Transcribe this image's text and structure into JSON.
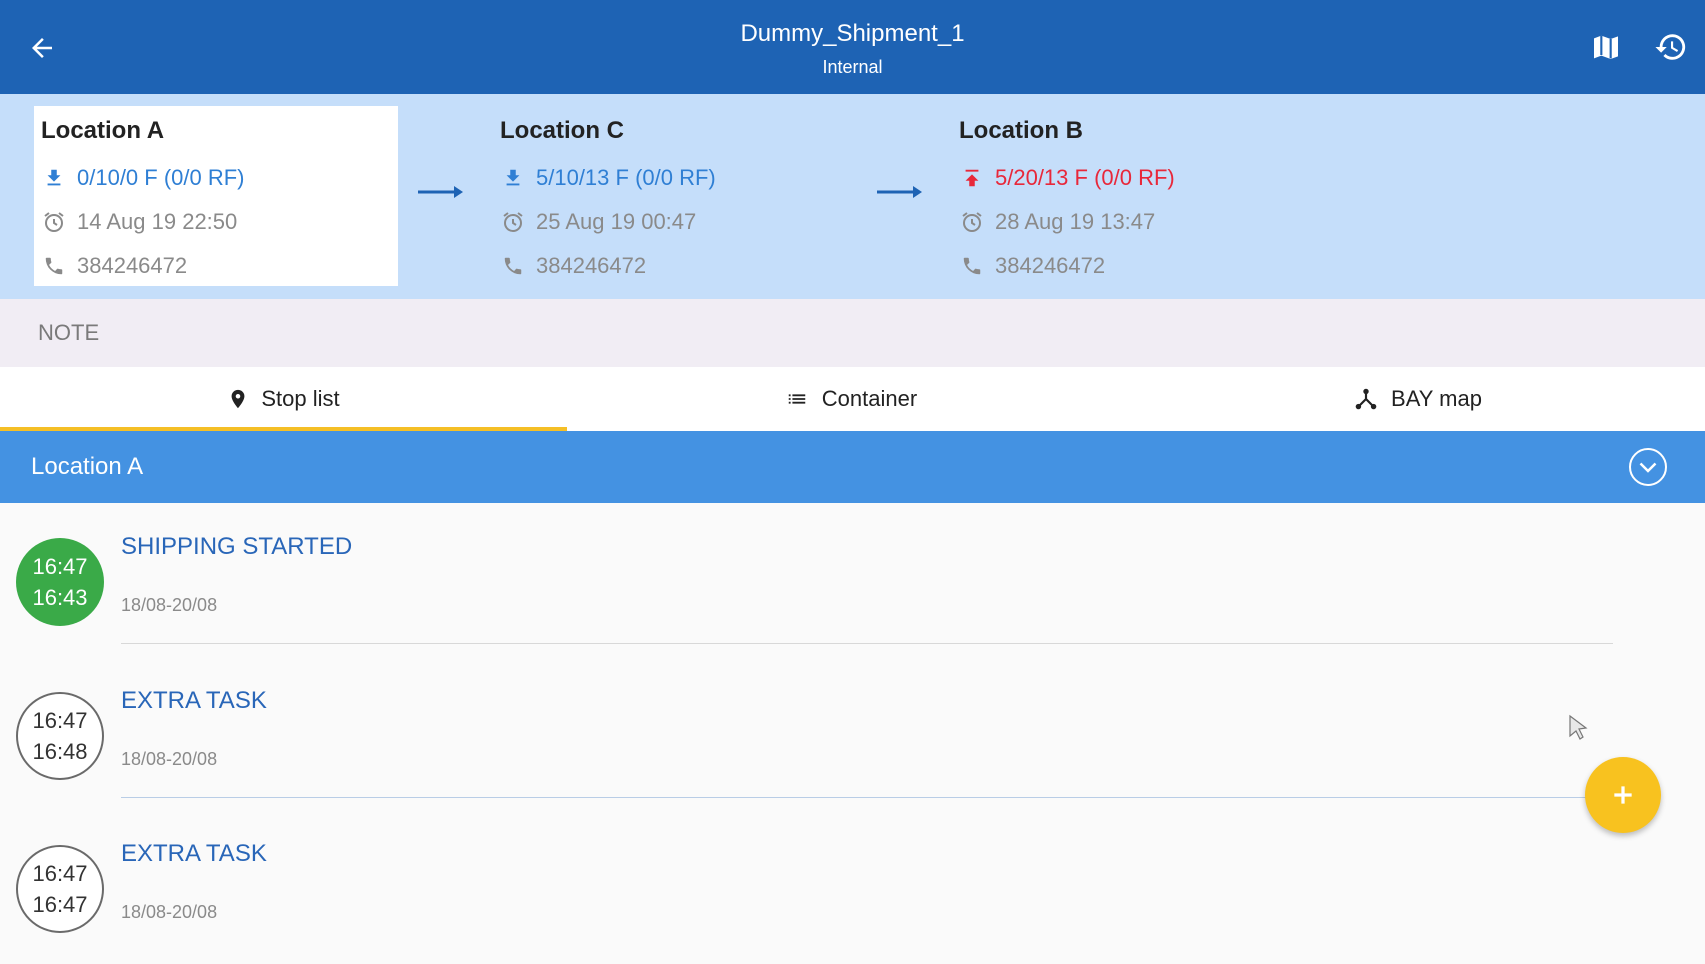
{
  "header": {
    "title": "Dummy_Shipment_1",
    "subtitle": "Internal",
    "back_icon": "arrow-left-icon",
    "map_icon": "map-icon",
    "history_icon": "history-icon"
  },
  "stops": [
    {
      "name": "Location A",
      "count": "0/10/0 F (0/0 RF)",
      "count_icon": "download-icon",
      "count_color": "#2f7fd4",
      "time": "14 Aug 19 22:50",
      "phone": "384246472",
      "active": true
    },
    {
      "name": "Location C",
      "count": "5/10/13 F (0/0 RF)",
      "count_icon": "download-icon",
      "count_color": "#2f7fd4",
      "time": "25 Aug 19 00:47",
      "phone": "384246472",
      "active": false
    },
    {
      "name": "Location B",
      "count": "5/20/13 F (0/0 RF)",
      "count_icon": "upload-icon",
      "count_color": "#e8283a",
      "time": "28 Aug 19 13:47",
      "phone": "384246472",
      "active": false
    }
  ],
  "note": {
    "label": "NOTE"
  },
  "tabs": [
    {
      "label": "Stop list",
      "icon": "location-pin-icon",
      "active": true
    },
    {
      "label": "Container",
      "icon": "list-icon",
      "active": false
    },
    {
      "label": "BAY map",
      "icon": "hub-icon",
      "active": false
    }
  ],
  "section": {
    "title": "Location A",
    "icon": "chevron-down-circle-icon"
  },
  "tasks": [
    {
      "time_top": "16:47",
      "time_bottom": "16:43",
      "name": "SHIPPING STARTED",
      "dates": "18/08-20/08",
      "status": "done"
    },
    {
      "time_top": "16:47",
      "time_bottom": "16:48",
      "name": "EXTRA TASK",
      "dates": "18/08-20/08",
      "status": "pending"
    },
    {
      "time_top": "16:47",
      "time_bottom": "16:47",
      "name": "EXTRA TASK",
      "dates": "18/08-20/08",
      "status": "pending"
    }
  ],
  "fab": {
    "icon": "plus-icon",
    "color": "#f8c21f"
  },
  "colors": {
    "appbar": "#1e63b4",
    "stops_band": "#c5defa",
    "section": "#4492e2",
    "done": "#3aaa48",
    "tab_indicator": "#f5bf26"
  }
}
